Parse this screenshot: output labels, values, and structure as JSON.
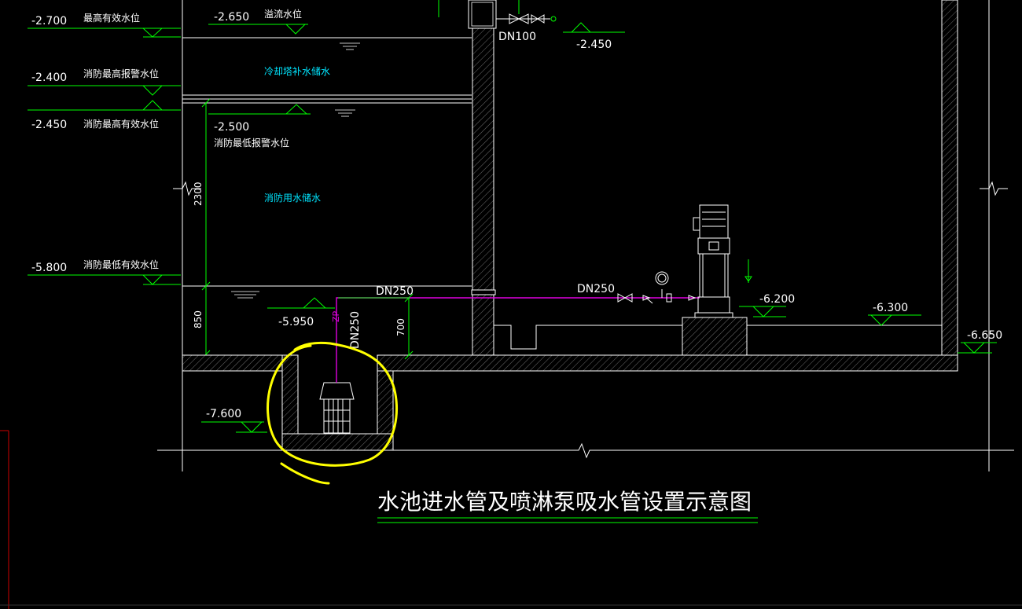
{
  "title": "水池进水管及喷淋泵吸水管设置示意图",
  "levels_left": [
    {
      "value": "-2.700",
      "label": "最高有效水位"
    },
    {
      "value": "-2.400",
      "label": "消防最高报警水位"
    },
    {
      "value": "-2.450",
      "label": "消防最高有效水位"
    },
    {
      "value": "-5.800",
      "label": "消防最低有效水位"
    }
  ],
  "level_overflow": {
    "value": "-2.650",
    "label": "溢流水位"
  },
  "level_alarm_low": {
    "value": "-2.500",
    "label": "消防最低报警水位"
  },
  "zones": {
    "cooling": "冷却塔补水储水",
    "fire": "消防用水储水"
  },
  "levels_misc": {
    "top_right": "-2.450",
    "sump_top": "-5.950",
    "sump_bottom": "-7.600",
    "pump": "-6.200",
    "room_floor": "-6.300",
    "outer": "-6.650"
  },
  "dims": {
    "upper": "2300",
    "lower": "850",
    "pipe_height": "700"
  },
  "pipes": {
    "inlet": "DN100",
    "suction_horizontal": "DN250",
    "pump_line": "DN250",
    "vertical": "DN250",
    "vertical_tag": "ZP"
  },
  "colors": {
    "background": "#000000",
    "line": "#00ff00",
    "text": "#ffffff",
    "cyan": "#00e5ff",
    "pipe": "#e000e0",
    "highlight": "#ffff00"
  }
}
